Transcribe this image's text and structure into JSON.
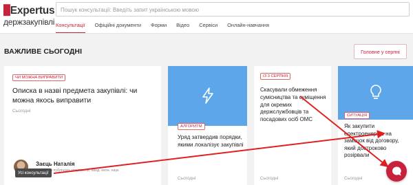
{
  "header": {
    "logo_top": "Expertus:",
    "logo_bottom": "держзакупівлі",
    "search_placeholder": "Пошук консультації: Введіть запит українською мовою",
    "nav": [
      "Консультації",
      "Офіційні документи",
      "Форми",
      "Відео",
      "Сервіси",
      "Онлайн-навчання"
    ]
  },
  "main": {
    "section_title": "ВАЖЛИВЕ СЬОГОДНІ",
    "serial_button": "Головне у серпні"
  },
  "cards": [
    {
      "tag": "ЧИ МОЖНА ВИПРАВИТИ",
      "title": "Описка в назві предмета закупівлі: чи можна якось виправити",
      "date": "Сьогодні",
      "author_name": "Заєць Наталія",
      "author_desc": "Експерт з публічних закупівель, канд. екон. наук"
    },
    {
      "tag": "АЛГОРИТМ",
      "title": "Уряд затвердив порядки, якими локалізує закупівлі",
      "date": "Сьогодні",
      "icon": "lightning-icon"
    },
    {
      "tag": "ІЗ 3 СЕРПНЯ",
      "title": "Скасували обмеження сумісництва та суміщення для окремих держслужбовців та посадових осіб ОМС",
      "date": "Сьогодні"
    },
    {
      "tag": "СИТУАЦІЯ",
      "title": "Як закупити електроенергію на заміщок від договору, який достроково розірвали",
      "date": "Сьогодні",
      "icon": "lightbulb-icon"
    }
  ],
  "tooltip": "Усі консультації",
  "colors": {
    "accent": "#c8213b",
    "image_blue": "#5ea6ea",
    "arrow_red": "#e02020"
  }
}
